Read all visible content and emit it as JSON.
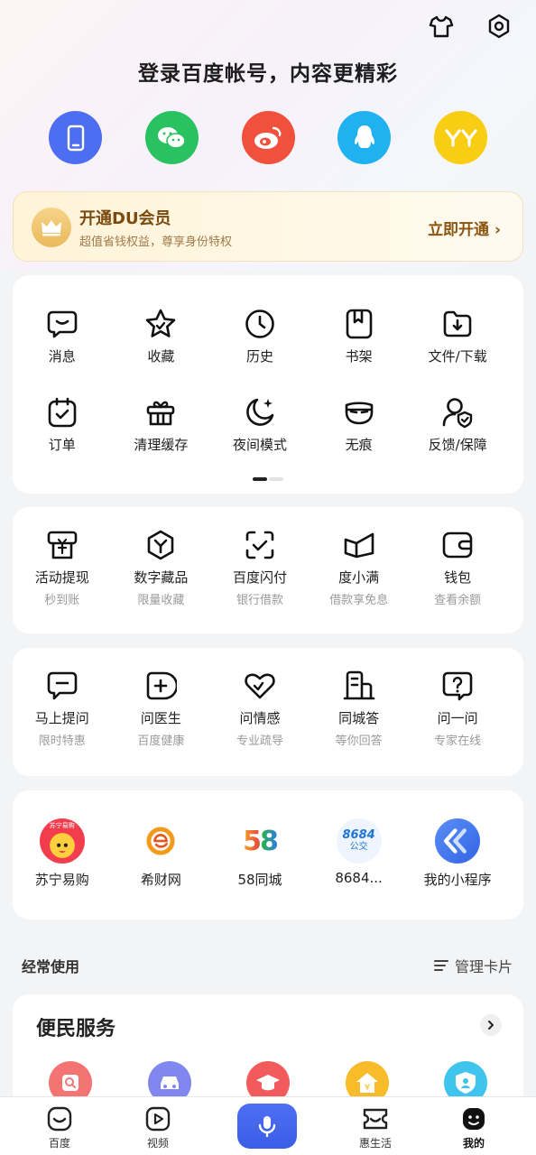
{
  "login": {
    "title": "登录百度帐号，内容更精彩",
    "methods": [
      {
        "name": "phone",
        "color": "#4e6ef2"
      },
      {
        "name": "wechat",
        "color": "#2ac160"
      },
      {
        "name": "weibo",
        "color": "#f0503c"
      },
      {
        "name": "qq",
        "color": "#1fb1f0"
      },
      {
        "name": "yy",
        "color": "#f7ce14"
      }
    ]
  },
  "vip": {
    "title": "开通DU会员",
    "subtitle": "超值省钱权益，尊享身份特权",
    "cta": "立即开通 ›"
  },
  "tools": [
    {
      "label": "消息",
      "icon": "message-icon"
    },
    {
      "label": "收藏",
      "icon": "star-icon"
    },
    {
      "label": "历史",
      "icon": "clock-icon"
    },
    {
      "label": "书架",
      "icon": "bookshelf-icon"
    },
    {
      "label": "文件/下载",
      "icon": "download-folder-icon"
    },
    {
      "label": "订单",
      "icon": "order-icon"
    },
    {
      "label": "清理缓存",
      "icon": "gift-box-icon"
    },
    {
      "label": "夜间模式",
      "icon": "moon-icon"
    },
    {
      "label": "无痕",
      "icon": "mask-icon"
    },
    {
      "label": "反馈/保障",
      "icon": "feedback-shield-icon"
    }
  ],
  "finance": [
    {
      "label": "活动提现",
      "sub": "秒到账"
    },
    {
      "label": "数字藏品",
      "sub": "限量收藏"
    },
    {
      "label": "百度闪付",
      "sub": "银行借款"
    },
    {
      "label": "度小满",
      "sub": "借款享免息"
    },
    {
      "label": "钱包",
      "sub": "查看余额"
    }
  ],
  "ask": [
    {
      "label": "马上提问",
      "sub": "限时特惠"
    },
    {
      "label": "问医生",
      "sub": "百度健康"
    },
    {
      "label": "问情感",
      "sub": "专业疏导"
    },
    {
      "label": "同城答",
      "sub": "等你回答"
    },
    {
      "label": "问一问",
      "sub": "专家在线"
    }
  ],
  "miniapps": [
    {
      "label": "苏宁易购",
      "badge": "苏宁易购"
    },
    {
      "label": "希财网"
    },
    {
      "label": "58同城",
      "badge": "58"
    },
    {
      "label": "8684...",
      "badge": "8684",
      "badge2": "公交"
    },
    {
      "label": "我的小程序"
    }
  ],
  "frequent": {
    "title": "经常使用",
    "manage": "管理卡片"
  },
  "services": {
    "title": "便民服务",
    "colors": [
      "#f26b6b",
      "#7b86f0",
      "#f25a5a",
      "#f7b824",
      "#3ec4ee"
    ]
  },
  "tabbar": [
    {
      "label": "百度"
    },
    {
      "label": "视频"
    },
    {
      "label": "惠生活"
    },
    {
      "label": "我的"
    }
  ]
}
